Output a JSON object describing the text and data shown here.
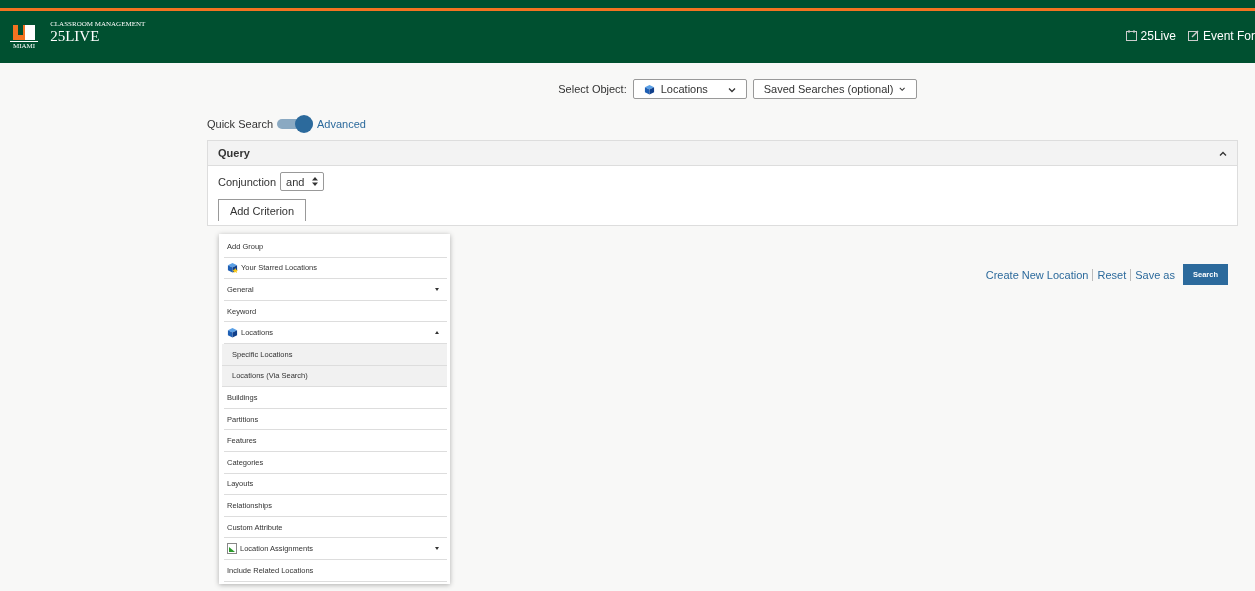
{
  "header": {
    "subtitle": "CLASSROOM MANAGEMENT",
    "title": "25LIVE",
    "logo_caption": "MIAMI",
    "links": [
      {
        "label": "25Live",
        "kind": "calendar"
      },
      {
        "label": "Event For",
        "kind": "edit"
      }
    ]
  },
  "select_object": {
    "label": "Select Object:",
    "object": "Locations",
    "saved_search": "Saved Searches (optional)"
  },
  "mode_toggle": {
    "left": "Quick Search",
    "right": "Advanced",
    "on": true
  },
  "query": {
    "title": "Query",
    "expanded": true,
    "conjunction_label": "Conjunction",
    "conjunction": "and",
    "add_button": "Add Criterion"
  },
  "menu": [
    {
      "label": "Add Group",
      "kind": "plain"
    },
    {
      "label": "Your Starred Locations",
      "kind": "starred"
    },
    {
      "label": "General",
      "kind": "plain",
      "expanded": false
    },
    {
      "label": "Keyword",
      "kind": "plain"
    },
    {
      "label": "Locations",
      "kind": "cube",
      "expanded": true,
      "children": [
        {
          "label": "Specific Locations"
        },
        {
          "label": "Locations (Via Search)"
        }
      ]
    },
    {
      "label": "Buildings",
      "kind": "plain"
    },
    {
      "label": "Partitions",
      "kind": "plain"
    },
    {
      "label": "Features",
      "kind": "plain"
    },
    {
      "label": "Categories",
      "kind": "plain"
    },
    {
      "label": "Layouts",
      "kind": "plain"
    },
    {
      "label": "Relationships",
      "kind": "plain"
    },
    {
      "label": "Custom Attribute",
      "kind": "plain"
    },
    {
      "label": "Location Assignments",
      "kind": "assign",
      "expanded": false
    },
    {
      "label": "Include Related Locations",
      "kind": "plain"
    }
  ],
  "actions": {
    "links": [
      "Create New Location",
      "Reset",
      "Save as"
    ],
    "search_button": "Search"
  }
}
